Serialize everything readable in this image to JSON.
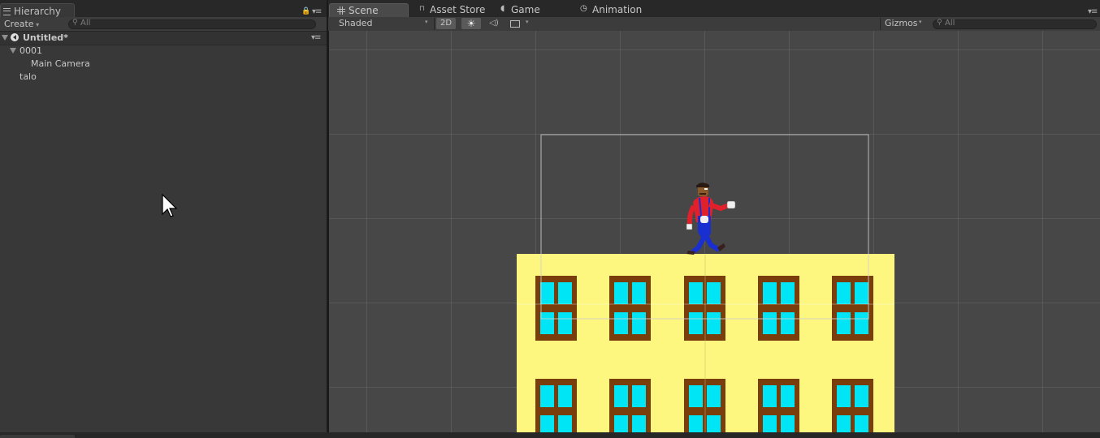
{
  "hierarchy": {
    "tab_label": "Hierarchy",
    "create_label": "Create",
    "search_placeholder": "All",
    "scene_name": "Untitled*",
    "items": [
      {
        "label": "0001"
      },
      {
        "label": "Main Camera"
      },
      {
        "label": "talo"
      }
    ]
  },
  "scene_tabs": [
    {
      "label": "Scene",
      "icon": "grid-icon"
    },
    {
      "label": "Asset Store",
      "icon": "shopping-bag-icon"
    },
    {
      "label": "Game",
      "icon": "pacman-icon"
    },
    {
      "label": "Animation",
      "icon": "clock-icon"
    }
  ],
  "scene_toolbar": {
    "draw_mode": "Shaded",
    "mode_2d": "2D",
    "gizmos_label": "Gizmos",
    "search_placeholder": "All"
  },
  "colors": {
    "building": "#fdf77f",
    "window_frame": "#7a3d0c",
    "window_glass": "#00e5f5",
    "shirt": "#e0202a",
    "pants": "#1a2fd0",
    "panel_bg": "#383838",
    "scene_bg": "#474747"
  }
}
